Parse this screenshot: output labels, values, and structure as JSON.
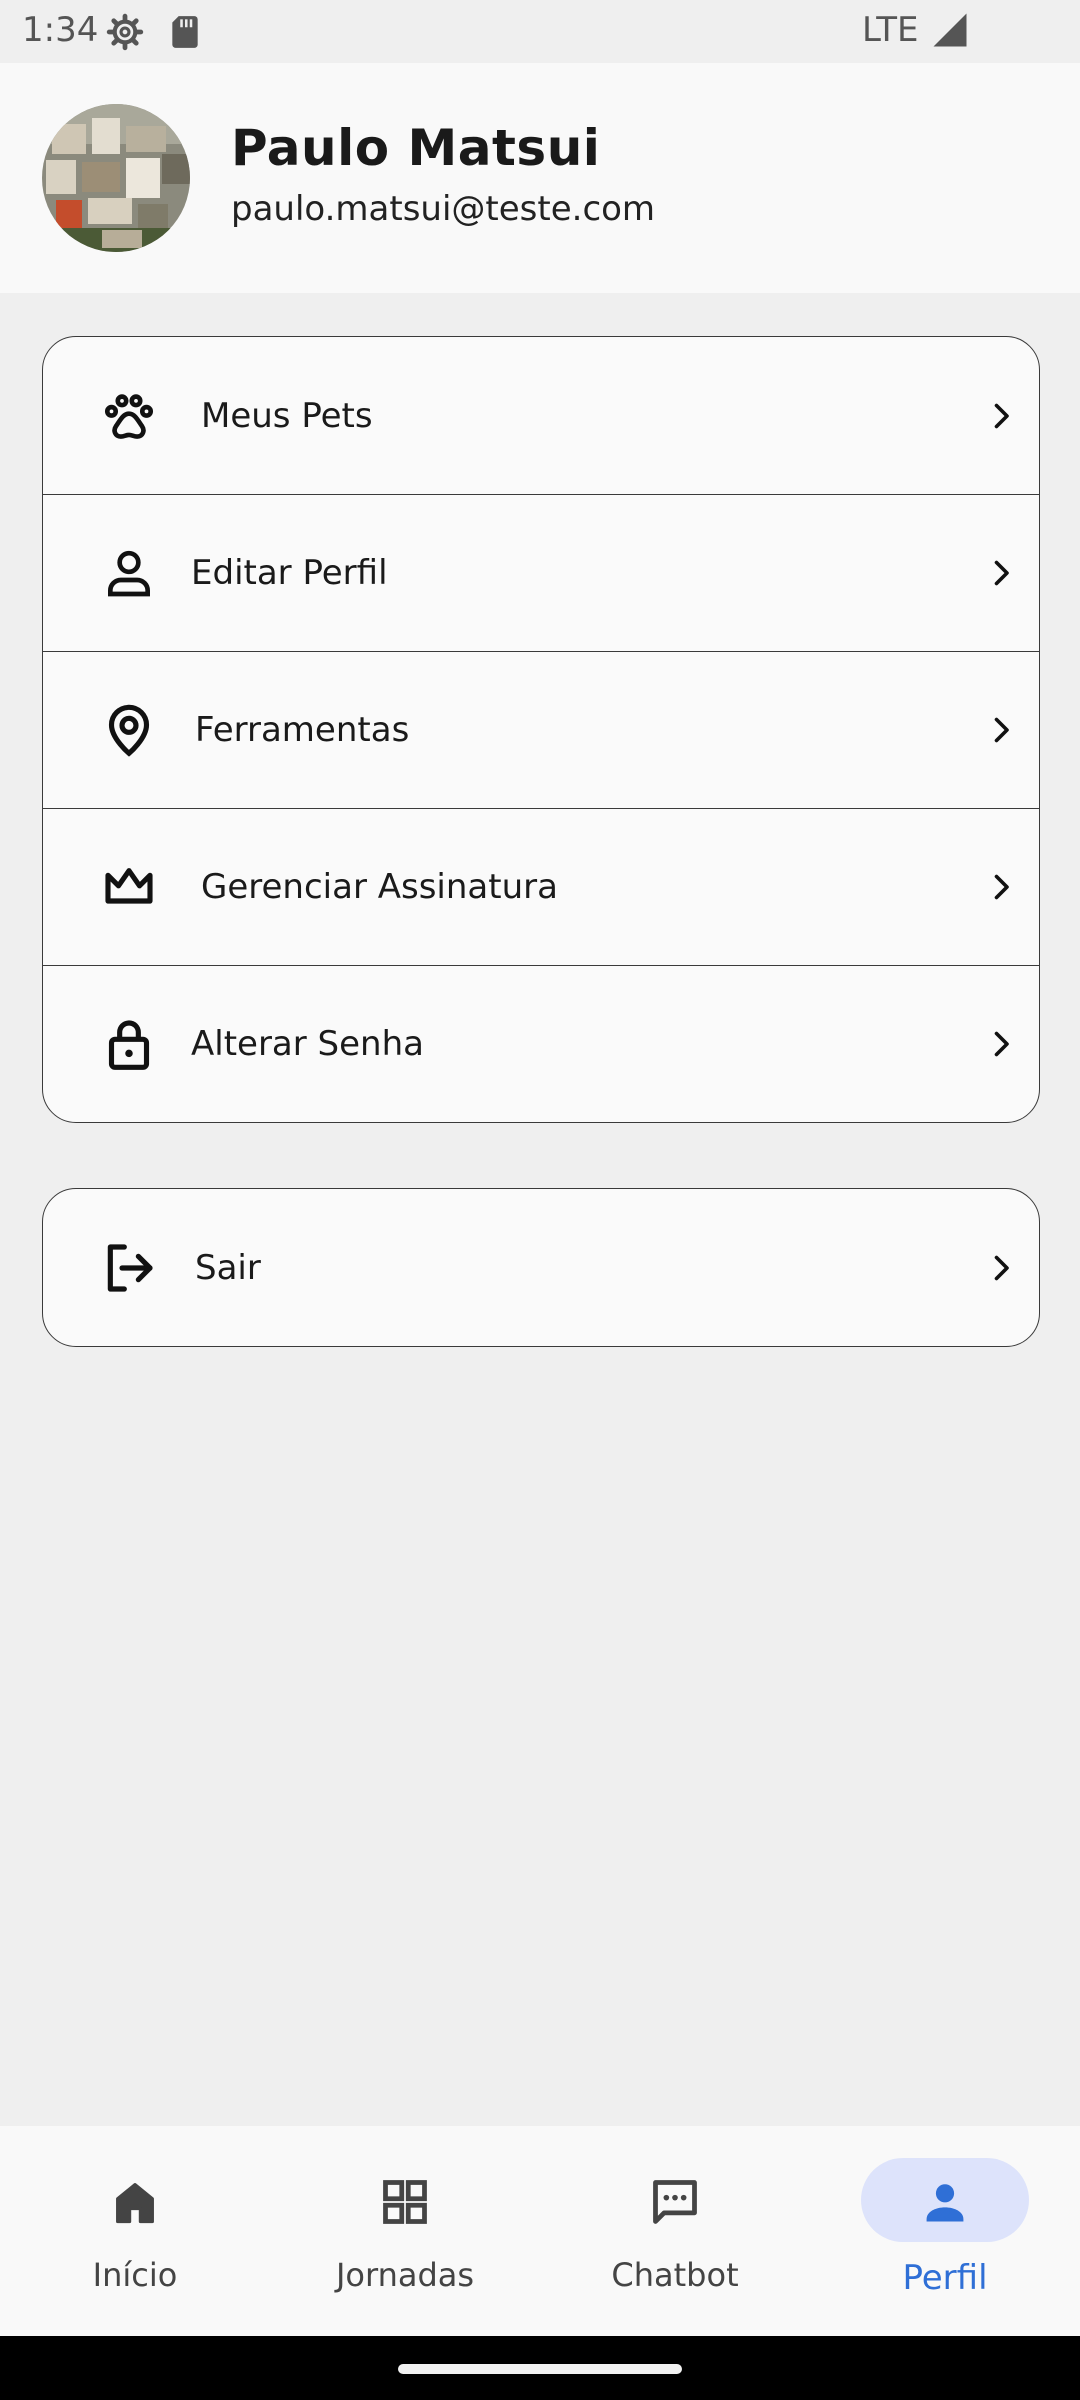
{
  "status_bar": {
    "time": "1:34",
    "network": "LTE",
    "icons": [
      "settings-gear-icon",
      "sd-card-icon",
      "signal-icon"
    ]
  },
  "profile": {
    "name": "Paulo Matsui",
    "email": "paulo.matsui@teste.com"
  },
  "menu": [
    {
      "label": "Meus Pets",
      "icon": "paw-icon"
    },
    {
      "label": "Editar Perfil",
      "icon": "person-icon"
    },
    {
      "label": "Ferramentas",
      "icon": "location-pin-icon"
    },
    {
      "label": "Gerenciar Assinatura",
      "icon": "crown-icon"
    },
    {
      "label": "Alterar Senha",
      "icon": "lock-icon"
    }
  ],
  "logout": {
    "label": "Sair",
    "icon": "logout-icon"
  },
  "bottom_nav": {
    "items": [
      {
        "label": "Início",
        "icon": "home-icon",
        "active": false
      },
      {
        "label": "Jornadas",
        "icon": "grid-icon",
        "active": false
      },
      {
        "label": "Chatbot",
        "icon": "chat-bubble-icon",
        "active": false
      },
      {
        "label": "Perfil",
        "icon": "person-icon",
        "active": true
      }
    ]
  },
  "colors": {
    "accent": "#2f6fd6",
    "active_pill": "#dde3fb",
    "background": "#efefef",
    "surface": "#fafafa"
  }
}
